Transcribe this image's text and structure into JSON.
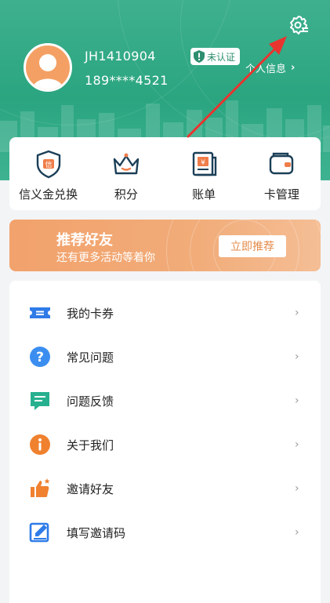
{
  "header": {
    "user_id": "JH1410904",
    "phone": "189****4521",
    "verify_badge": "未认证",
    "profile_link": "个人信息",
    "bg_color": "#2aa580"
  },
  "quick_actions": [
    {
      "label": "信义金兑换",
      "icon": "credit-shield-icon"
    },
    {
      "label": "积分",
      "icon": "crown-icon"
    },
    {
      "label": "账单",
      "icon": "bill-icon"
    },
    {
      "label": "卡管理",
      "icon": "wallet-icon"
    }
  ],
  "banner": {
    "title": "推荐好友",
    "subtitle": "还有更多活动等着你",
    "button_label": "立即推荐",
    "color": "#f2a26c"
  },
  "menu": [
    {
      "label": "我的卡券",
      "icon": "coupon-icon"
    },
    {
      "label": "常见问题",
      "icon": "question-icon"
    },
    {
      "label": "问题反馈",
      "icon": "feedback-icon"
    },
    {
      "label": "关于我们",
      "icon": "info-icon"
    },
    {
      "label": "邀请好友",
      "icon": "thumbs-up-icon"
    },
    {
      "label": "填写邀请码",
      "icon": "edit-icon"
    }
  ],
  "accent": "#2aa580"
}
